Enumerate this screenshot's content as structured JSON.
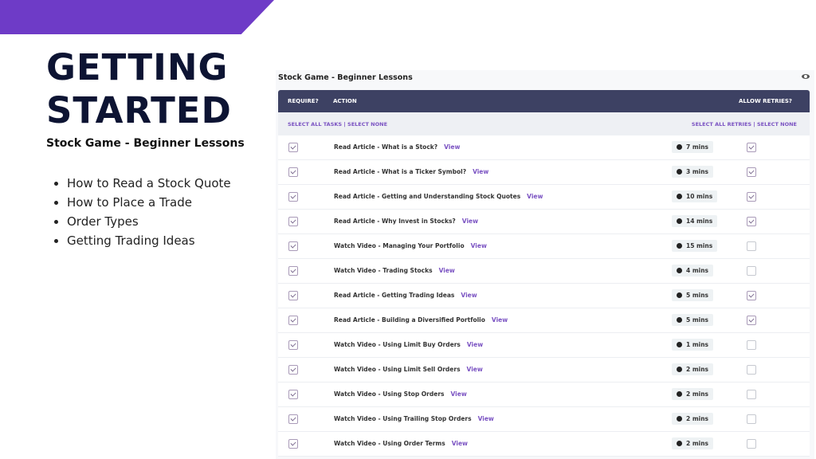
{
  "slide": {
    "title_line1": "GETTING",
    "title_line2": "STARTED",
    "subtitle": "Stock Game - Beginner Lessons",
    "bullets": [
      "How to Read a Stock Quote",
      "How to Place a Trade",
      "Order Types",
      "Getting Trading Ideas"
    ],
    "accent_color": "#6e3bc7"
  },
  "panel": {
    "title": "Stock Game - Beginner Lessons",
    "eye_icon": "eye-icon",
    "header": {
      "require": "REQUIRE?",
      "action": "ACTION",
      "allow_retries": "ALLOW RETRIES?"
    },
    "select_tasks": "SELECT ALL TASKS | SELECT NONE",
    "select_retries": "SELECT ALL RETRIES | SELECT NONE",
    "view_label": "View",
    "rows": [
      {
        "action": "Read Article - What is a Stock?",
        "duration": "7 mins",
        "required": true,
        "retries": true
      },
      {
        "action": "Read Article - What is a Ticker Symbol?",
        "duration": "3 mins",
        "required": true,
        "retries": true
      },
      {
        "action": "Read Article - Getting and Understanding Stock Quotes",
        "duration": "10 mins",
        "required": true,
        "retries": true
      },
      {
        "action": "Read Article - Why Invest in Stocks?",
        "duration": "14 mins",
        "required": true,
        "retries": true
      },
      {
        "action": "Watch Video - Managing Your Portfolio",
        "duration": "15 mins",
        "required": true,
        "retries": false
      },
      {
        "action": "Watch Video - Trading Stocks",
        "duration": "4 mins",
        "required": true,
        "retries": false
      },
      {
        "action": "Read Article - Getting Trading Ideas",
        "duration": "5 mins",
        "required": true,
        "retries": true
      },
      {
        "action": "Read Article - Building a Diversified Portfolio",
        "duration": "5 mins",
        "required": true,
        "retries": true
      },
      {
        "action": "Watch Video - Using Limit Buy Orders",
        "duration": "1 mins",
        "required": true,
        "retries": false
      },
      {
        "action": "Watch Video - Using Limit Sell Orders",
        "duration": "2 mins",
        "required": true,
        "retries": false
      },
      {
        "action": "Watch Video - Using Stop Orders",
        "duration": "2 mins",
        "required": true,
        "retries": false
      },
      {
        "action": "Watch Video - Using Trailing Stop Orders",
        "duration": "2 mins",
        "required": true,
        "retries": false
      },
      {
        "action": "Watch Video - Using Order Terms",
        "duration": "2 mins",
        "required": true,
        "retries": false
      }
    ]
  }
}
